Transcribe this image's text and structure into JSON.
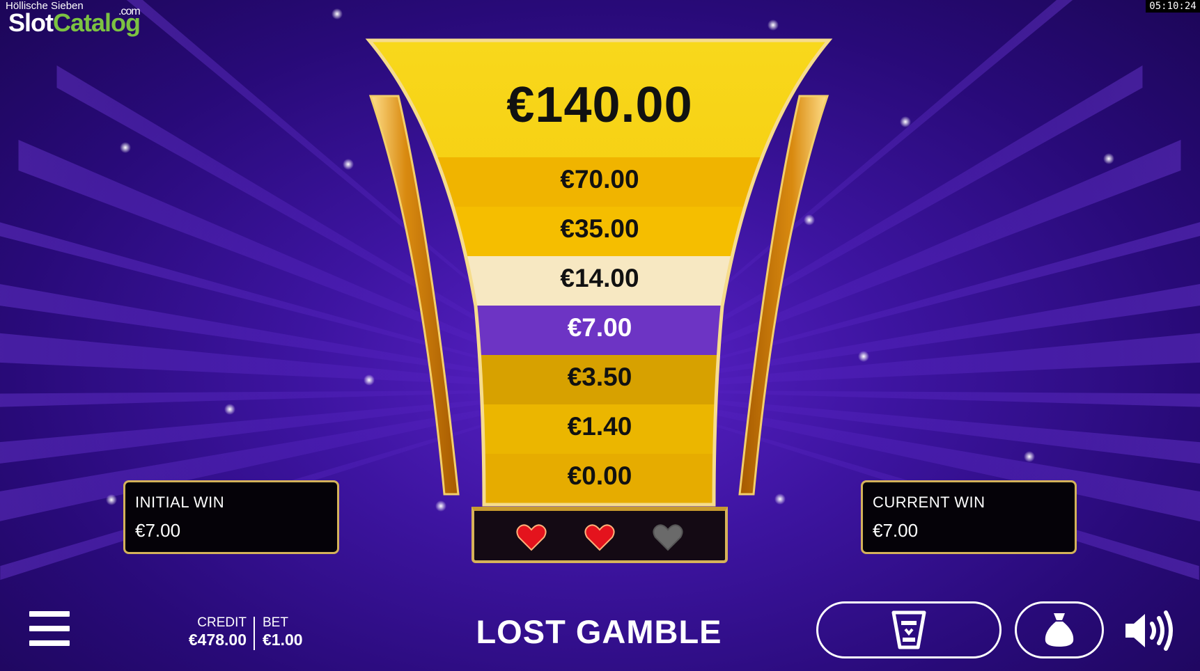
{
  "header": {
    "game_title": "Höllische Sieben",
    "watermark": {
      "part1": "Slot",
      "part2": "Catalog",
      "part3": ".com"
    },
    "clock": "05:10:24"
  },
  "ladder": {
    "top_prize": "€140.00",
    "steps": [
      {
        "label": "€70.00",
        "state": "normal"
      },
      {
        "label": "€35.00",
        "state": "normal"
      },
      {
        "label": "€14.00",
        "state": "highlight"
      },
      {
        "label": "€7.00",
        "state": "active"
      },
      {
        "label": "€3.50",
        "state": "normal"
      },
      {
        "label": "€1.40",
        "state": "normal"
      },
      {
        "label": "€0.00",
        "state": "normal"
      }
    ],
    "lives": {
      "total": 3,
      "remaining": 2
    }
  },
  "initial_win": {
    "label": "INITIAL WIN",
    "value": "€7.00"
  },
  "current_win": {
    "label": "CURRENT WIN",
    "value": "€7.00"
  },
  "bottom_bar": {
    "credit_label": "CREDIT",
    "credit_value": "€478.00",
    "bet_label": "BET",
    "bet_value": "€1.00",
    "status": "LOST GAMBLE"
  },
  "colors": {
    "gold": "#f5c40c",
    "active_step": "#6d34c4",
    "highlight_step": "#f7e8c2",
    "frame": "#d6b25a"
  }
}
